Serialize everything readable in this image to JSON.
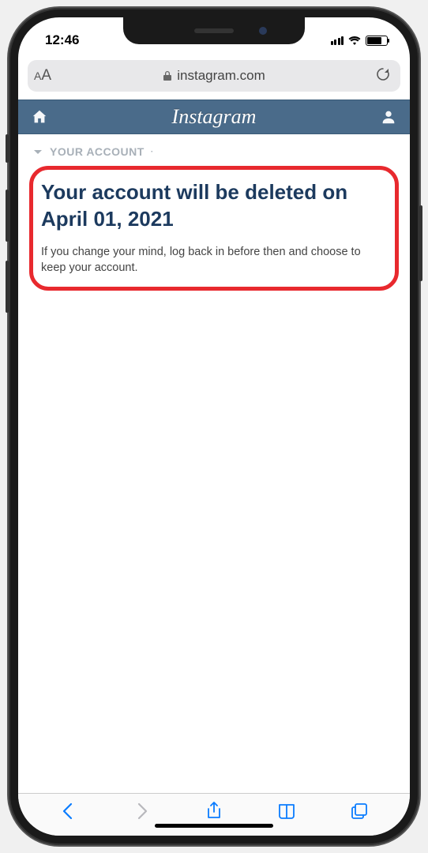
{
  "status": {
    "time": "12:46"
  },
  "browser": {
    "domain": "instagram.com"
  },
  "ig_header": {
    "brand": "Instagram"
  },
  "breadcrumb": {
    "label": "YOUR ACCOUNT",
    "sep": "·"
  },
  "content": {
    "heading": "Your account will be deleted on April 01, 2021",
    "body": "If you change your mind, log back in before then and choose to keep your account."
  }
}
